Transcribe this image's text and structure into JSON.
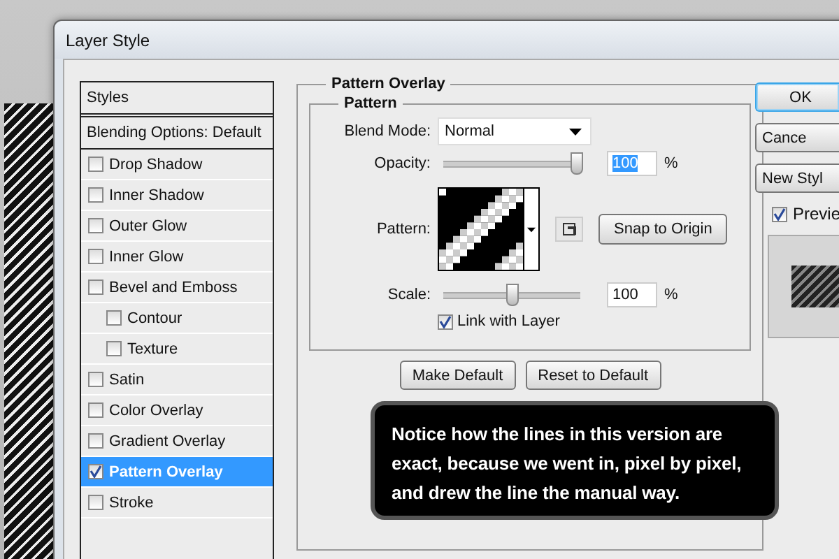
{
  "window": {
    "title": "Layer Style"
  },
  "styles_panel": {
    "header": "Styles",
    "blending_options": "Blending Options: Default",
    "items": [
      {
        "label": "Drop Shadow",
        "checked": false,
        "selected": false
      },
      {
        "label": "Inner Shadow",
        "checked": false,
        "selected": false
      },
      {
        "label": "Outer Glow",
        "checked": false,
        "selected": false
      },
      {
        "label": "Inner Glow",
        "checked": false,
        "selected": false
      },
      {
        "label": "Bevel and Emboss",
        "checked": false,
        "selected": false,
        "children": [
          {
            "label": "Contour",
            "checked": false,
            "selected": false
          },
          {
            "label": "Texture",
            "checked": false,
            "selected": false
          }
        ]
      },
      {
        "label": "Satin",
        "checked": false,
        "selected": false
      },
      {
        "label": "Color Overlay",
        "checked": false,
        "selected": false
      },
      {
        "label": "Gradient Overlay",
        "checked": false,
        "selected": false
      },
      {
        "label": "Pattern Overlay",
        "checked": true,
        "selected": true
      },
      {
        "label": "Stroke",
        "checked": false,
        "selected": false
      }
    ]
  },
  "pattern_overlay": {
    "title": "Pattern Overlay",
    "group": {
      "title": "Pattern",
      "blend_mode": {
        "label": "Blend Mode:",
        "value": "Normal"
      },
      "opacity": {
        "label": "Opacity:",
        "level": 0.97,
        "value": "100",
        "selected": true,
        "unit": "%"
      },
      "pattern": {
        "label": "Pattern:"
      },
      "snap_button": "Snap to Origin",
      "scale": {
        "label": "Scale:",
        "level": 0.5,
        "value": "100",
        "selected": false,
        "unit": "%"
      },
      "link_with_layer": {
        "label": "Link with Layer",
        "checked": true
      }
    },
    "buttons": [
      "Make Default",
      "Reset to Default"
    ]
  },
  "right_buttons": [
    {
      "label": "OK",
      "default": true
    },
    {
      "label": "Cance",
      "default": false
    },
    {
      "label": "New Styl",
      "default": false
    }
  ],
  "preview": {
    "label": "Previe",
    "checked": true
  },
  "callout": {
    "text": "Notice how the lines in this version are exact, because we went in, pixel by pixel, and drew the line the manual way."
  }
}
